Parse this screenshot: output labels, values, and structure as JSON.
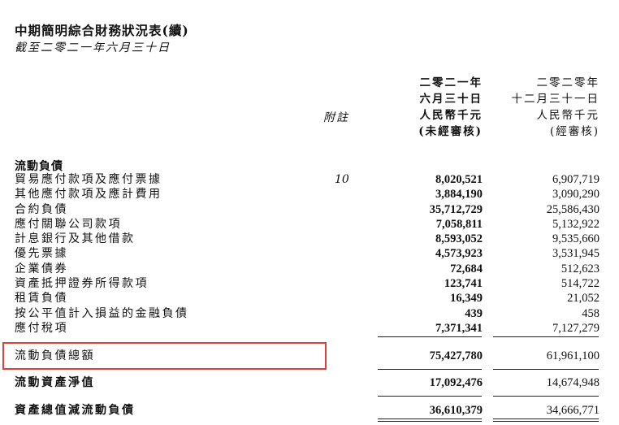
{
  "title": "中期簡明綜合財務狀況表(續)",
  "subtitle": "截至二零二一年六月三十日",
  "note_header": "附註",
  "col1_header": [
    "二零二一年",
    "六月三十日",
    "人民幣千元",
    "(未經審核)"
  ],
  "col2_header": [
    "二零二零年",
    "十二月三十一日",
    "人民幣千元",
    "(經審核)"
  ],
  "section_title": "流動負債",
  "rows": [
    {
      "label": "貿易應付款項及應付票據",
      "note": "10",
      "v1": "8,020,521",
      "v2": "6,907,719"
    },
    {
      "label": "其他應付款項及應計費用",
      "note": "",
      "v1": "3,884,190",
      "v2": "3,090,290"
    },
    {
      "label": "合約負債",
      "note": "",
      "v1": "35,712,729",
      "v2": "25,586,430"
    },
    {
      "label": "應付關聯公司款項",
      "note": "",
      "v1": "7,058,811",
      "v2": "5,132,922"
    },
    {
      "label": "計息銀行及其他借款",
      "note": "",
      "v1": "8,593,052",
      "v2": "9,535,660"
    },
    {
      "label": "優先票據",
      "note": "",
      "v1": "4,573,923",
      "v2": "3,531,945"
    },
    {
      "label": "企業債券",
      "note": "",
      "v1": "72,684",
      "v2": "512,623"
    },
    {
      "label": "資產抵押證券所得款項",
      "note": "",
      "v1": "123,741",
      "v2": "514,722"
    },
    {
      "label": "租賃負債",
      "note": "",
      "v1": "16,349",
      "v2": "21,052"
    },
    {
      "label": "按公平值計入損益的金融負債",
      "note": "",
      "v1": "439",
      "v2": "458"
    },
    {
      "label": "應付稅項",
      "note": "",
      "v1": "7,371,341",
      "v2": "7,127,279"
    }
  ],
  "totals": [
    {
      "label": "流動負債總額",
      "v1": "75,427,780",
      "v2": "61,961,100"
    },
    {
      "label": "流動資產淨值",
      "v1": "17,092,476",
      "v2": "14,674,948"
    },
    {
      "label": "資產總值減流動負債",
      "v1": "36,610,379",
      "v2": "34,666,771"
    }
  ],
  "highlight_color": "#d9423a"
}
